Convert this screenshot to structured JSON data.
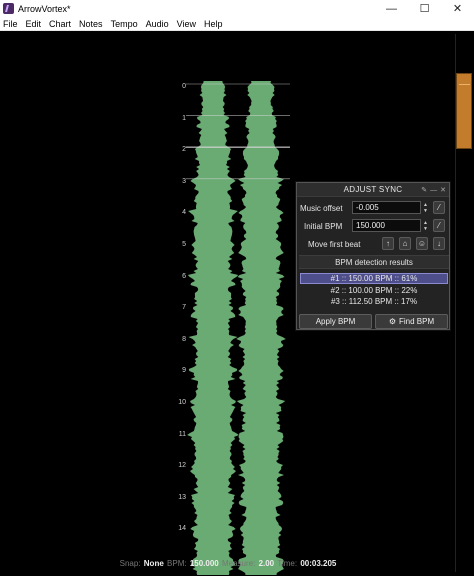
{
  "window": {
    "title": "ArrowVortex*",
    "minimize_glyph": "—",
    "maximize_glyph": "☐",
    "close_glyph": "✕"
  },
  "menu": [
    "File",
    "Edit",
    "Chart",
    "Notes",
    "Tempo",
    "Audio",
    "View",
    "Help"
  ],
  "beat_labels": [
    "0",
    "1",
    "2",
    "3",
    "4",
    "5",
    "6",
    "7",
    "8",
    "9",
    "10",
    "11",
    "12",
    "13",
    "14"
  ],
  "panel": {
    "title": "ADJUST SYNC",
    "tool_icons": [
      "pin-icon",
      "minimize-icon",
      "close-icon"
    ],
    "music_offset_label": "Music offset",
    "music_offset_value": "-0.005",
    "initial_bpm_label": "Initial BPM",
    "initial_bpm_value": "150.000",
    "move_first_beat_label": "Move first beat",
    "bpm_results_header": "BPM detection results",
    "bpm_results": [
      "#1 :: 150.00 BPM :: 61%",
      "#2 :: 100.00 BPM :: 22%",
      "#3 :: 112.50 BPM :: 17%"
    ],
    "apply_bpm_label": "Apply BPM",
    "find_bpm_label": "Find BPM"
  },
  "status": {
    "snap_label": "Snap:",
    "snap_value": "None",
    "bpm_label": "BPM:",
    "bpm_value": "150.000",
    "measure_label": "Measure:",
    "measure_value": "2.00",
    "time_label": "Time:",
    "time_value": "00:03.205"
  },
  "colors": {
    "waveform": "#6aaa73",
    "waveform_core": "#5e9c68",
    "scroll_thumb": "#c27c2c",
    "selected_result": "#4e4e8a"
  }
}
